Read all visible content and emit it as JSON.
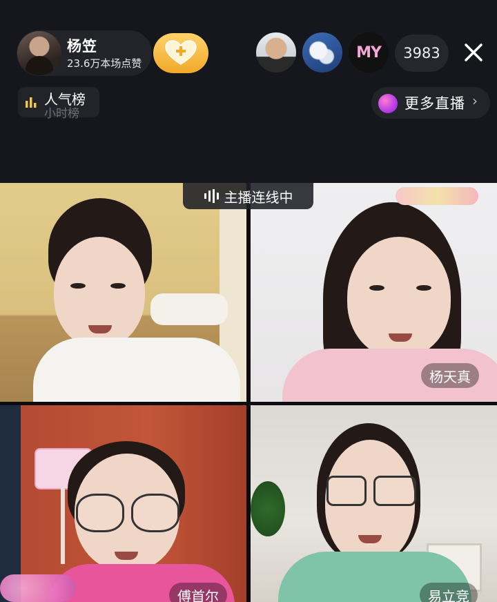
{
  "host": {
    "name": "杨笠",
    "likes": "23.6万本场点赞"
  },
  "viewers": {
    "avatar3_text": "MY",
    "count": "3983"
  },
  "rank": {
    "title": "人气榜",
    "subtitle": "小时榜"
  },
  "more_live": {
    "label": "更多直播",
    "chevron": "›"
  },
  "connection": {
    "label": "主播连线中"
  },
  "guests": [
    {
      "name": ""
    },
    {
      "name": "杨天真"
    },
    {
      "name": "傅首尔"
    },
    {
      "name": "易立竞"
    }
  ],
  "colors": {
    "background": "#15171d",
    "follow_gold": "#f1a92a",
    "more_live_icon": "#b63ee6"
  },
  "icons": [
    "heart-plus-icon",
    "close-icon",
    "bar-chart-icon",
    "live-sound-icon"
  ]
}
